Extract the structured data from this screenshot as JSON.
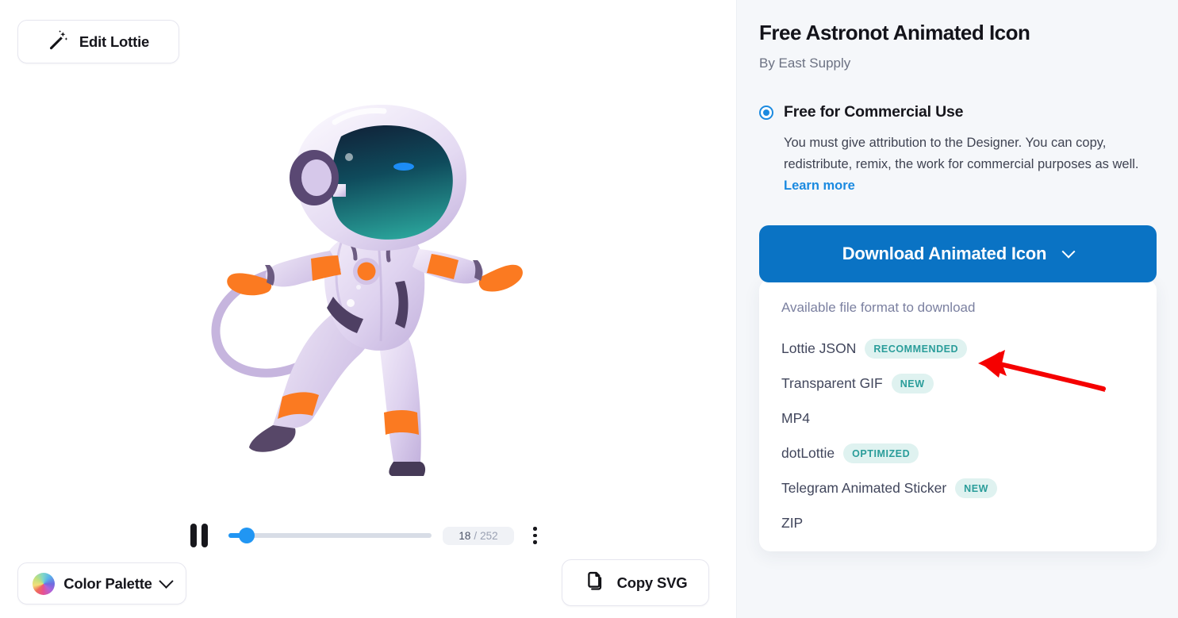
{
  "player": {
    "edit_button": {
      "label": "Edit Lottie",
      "icon": "magic-wand-icon"
    },
    "color_palette_button": {
      "label": "Color Palette",
      "icon": "color-wheel-icon",
      "chevron": "chevron-down-icon"
    },
    "copy_svg_button": {
      "label": "Copy SVG",
      "icon": "copy-pages-icon"
    },
    "playback": {
      "state_icon": "pause-icon",
      "current_frame": "18",
      "frame_separator": " / ",
      "total_frames": "252",
      "progress_percent": 9,
      "more_icon": "more-vertical-icon"
    },
    "artwork": {
      "name": "astronaut-illustration",
      "colors": {
        "suit_light": "#efe7f6",
        "suit_mid": "#d8c9ea",
        "suit_shadow": "#b9a8d4",
        "accent_orange": "#fb7a21",
        "dark_purple": "#4e3f63",
        "visor_dark": "#123049",
        "visor_teal": "#1d8d8a",
        "visor_glint": "#1e90ff"
      }
    }
  },
  "details": {
    "title": "Free Astronot Animated Icon",
    "author": "By East Supply",
    "license": {
      "option_label": "Free for Commercial Use",
      "selected": true,
      "description": "You must give attribution to the Designer. You can copy, redistribute, remix, the work for commercial purposes as well. ",
      "learn_more": "Learn more"
    },
    "download": {
      "label": "Download Animated Icon",
      "chevron": "chevron-down-icon",
      "accent_color": "#0a73c4"
    },
    "formats": {
      "label": "Available file format to download",
      "items": [
        {
          "name": "Lottie JSON",
          "badge": "RECOMMENDED"
        },
        {
          "name": "Transparent GIF",
          "badge": "NEW"
        },
        {
          "name": "MP4",
          "badge": ""
        },
        {
          "name": "dotLottie",
          "badge": "OPTIMIZED"
        },
        {
          "name": "Telegram Animated Sticker",
          "badge": "NEW"
        },
        {
          "name": "ZIP",
          "badge": ""
        }
      ],
      "badge_color": "#2a9d9a",
      "badge_bg": "#dff2f0"
    }
  },
  "annotation": {
    "arrow_color": "#f50000",
    "points_at": "Lottie JSON RECOMMENDED"
  }
}
